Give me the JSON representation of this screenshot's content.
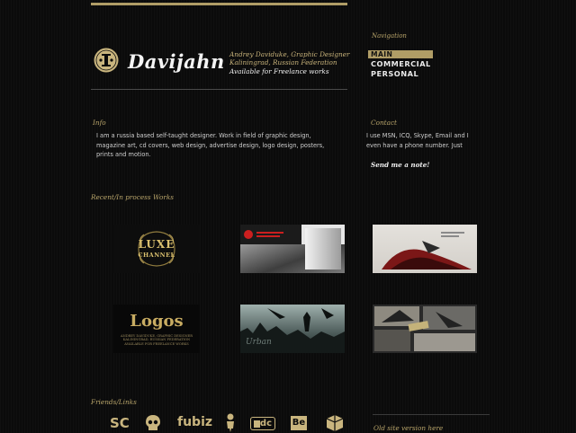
{
  "brand": {
    "name": "Davijahn",
    "tagline_line1": "Andrey Daviduke, Graphic Designer",
    "tagline_line2": "Kaliningrad, Russian Federation",
    "tagline_line3": "Available  for Freelance works"
  },
  "nav": {
    "heading": "Navigation",
    "items": [
      "MAIN",
      "COMMERCIAL",
      "PERSONAL"
    ],
    "active": "MAIN"
  },
  "info": {
    "heading": "Info",
    "text": "I am a russia based self-taught designer. Work in field of graphic design, magazine art, cd covers, web design, advertise design, logo design, posters, prints and motion."
  },
  "contact": {
    "heading": "Contact",
    "text": "I use MSN, ICQ, Skype, Email and I even have a phone number. Just",
    "link": "Send me a note!"
  },
  "works": {
    "heading": "Recent/In process Works",
    "thumb_luxe_line1": "LUXE",
    "thumb_luxe_line2": "CHANNEL",
    "thumb_logos_title": "Logos",
    "thumb_logos_sub1": "ANDREY DAVIDUKE, GRAPHIC DESIGNER",
    "thumb_logos_sub2": "KALININGRAD, RUSSIAN FEDERATION",
    "thumb_logos_sub3": "AVAILABLE FOR FREELANCE WORKS",
    "thumb_urban_title": "Urban"
  },
  "friends": {
    "heading": "Friends/Links",
    "icons": [
      "sc-icon",
      "skull-icon",
      "fubiz-icon",
      "figure-icon",
      "dc-icon",
      "behance-icon",
      "box-icon"
    ],
    "label_sc": "SC",
    "label_fubiz": "fubiz",
    "label_dc": "dc",
    "label_be": "Be"
  },
  "old_site": "Old site version here",
  "colors": {
    "accent": "#b09d66",
    "background": "#0b0b0b"
  }
}
